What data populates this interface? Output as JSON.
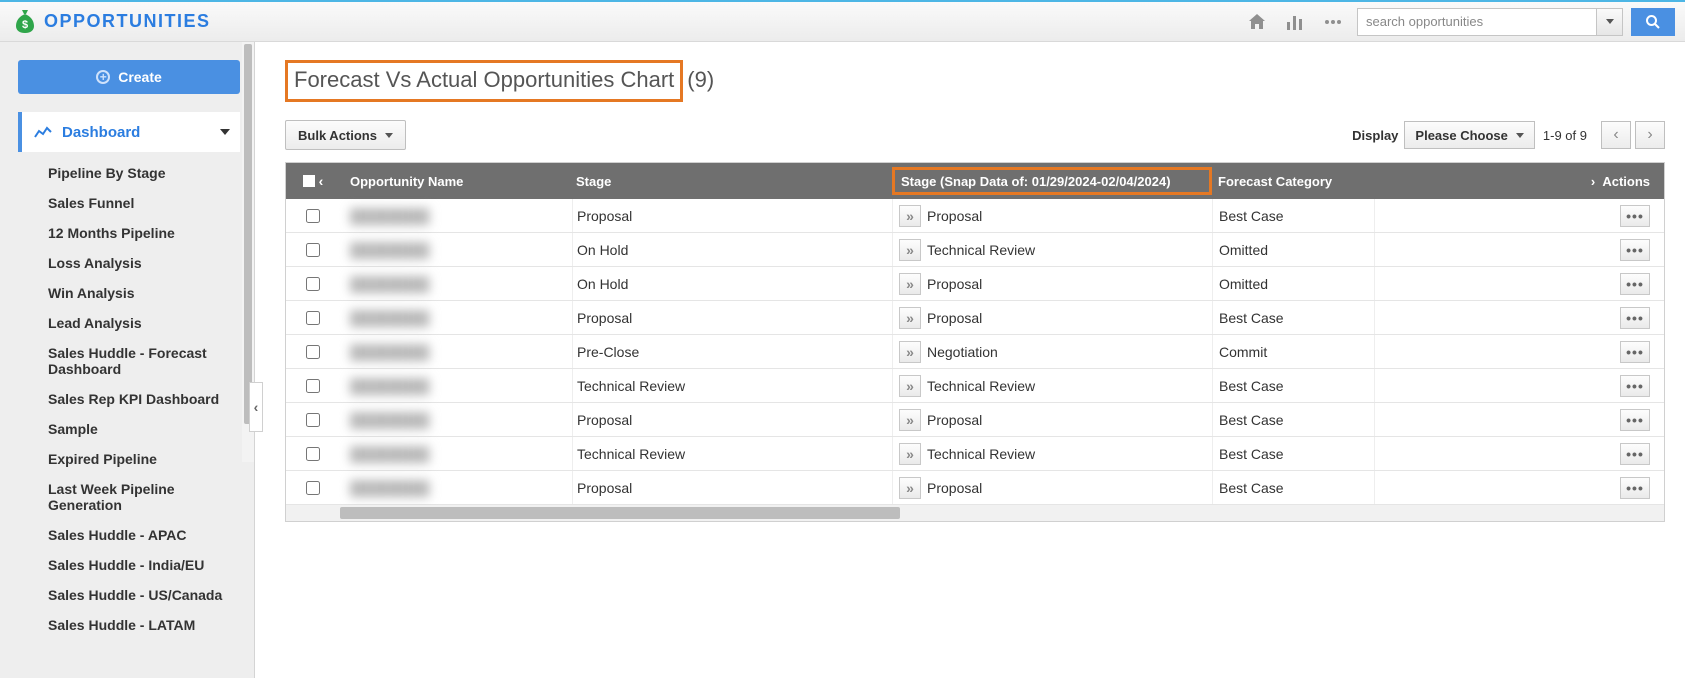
{
  "header": {
    "app_title": "OPPORTUNITIES",
    "search_placeholder": "search opportunities"
  },
  "sidebar": {
    "create_label": "Create",
    "parent_label": "Dashboard",
    "items": [
      {
        "label": "Pipeline By Stage"
      },
      {
        "label": "Sales Funnel"
      },
      {
        "label": "12 Months Pipeline"
      },
      {
        "label": "Loss Analysis"
      },
      {
        "label": "Win Analysis"
      },
      {
        "label": "Lead Analysis"
      },
      {
        "label": "Sales Huddle - Forecast Dashboard"
      },
      {
        "label": "Sales Rep KPI Dashboard"
      },
      {
        "label": "Sample"
      },
      {
        "label": "Expired Pipeline"
      },
      {
        "label": "Last Week Pipeline Generation"
      },
      {
        "label": "Sales Huddle - APAC"
      },
      {
        "label": "Sales Huddle - India/EU"
      },
      {
        "label": "Sales Huddle - US/Canada"
      },
      {
        "label": "Sales Huddle - LATAM"
      }
    ]
  },
  "main": {
    "title": "Forecast Vs Actual Opportunities Chart",
    "count": "(9)",
    "bulk_actions_label": "Bulk Actions",
    "display_label": "Display",
    "please_choose": "Please Choose",
    "range_text": "1-9 of 9"
  },
  "table": {
    "headers": {
      "name": "Opportunity Name",
      "stage": "Stage",
      "snap": "Stage (Snap Data of: 01/29/2024-02/04/2024)",
      "forecast": "Forecast Category",
      "actions": "Actions"
    },
    "rows": [
      {
        "name": "████████",
        "stage": "Proposal",
        "snap": "Proposal",
        "forecast": "Best Case"
      },
      {
        "name": "████████",
        "stage": "On Hold",
        "snap": "Technical Review",
        "forecast": "Omitted"
      },
      {
        "name": "████████",
        "stage": "On Hold",
        "snap": "Proposal",
        "forecast": "Omitted"
      },
      {
        "name": "████████",
        "stage": "Proposal",
        "snap": "Proposal",
        "forecast": "Best Case"
      },
      {
        "name": "████████",
        "stage": "Pre-Close",
        "snap": "Negotiation",
        "forecast": "Commit"
      },
      {
        "name": "████████",
        "stage": "Technical Review",
        "snap": "Technical Review",
        "forecast": "Best Case"
      },
      {
        "name": "████████",
        "stage": "Proposal",
        "snap": "Proposal",
        "forecast": "Best Case"
      },
      {
        "name": "████████",
        "stage": "Technical Review",
        "snap": "Technical Review",
        "forecast": "Best Case"
      },
      {
        "name": "████████",
        "stage": "Proposal",
        "snap": "Proposal",
        "forecast": "Best Case"
      }
    ]
  }
}
